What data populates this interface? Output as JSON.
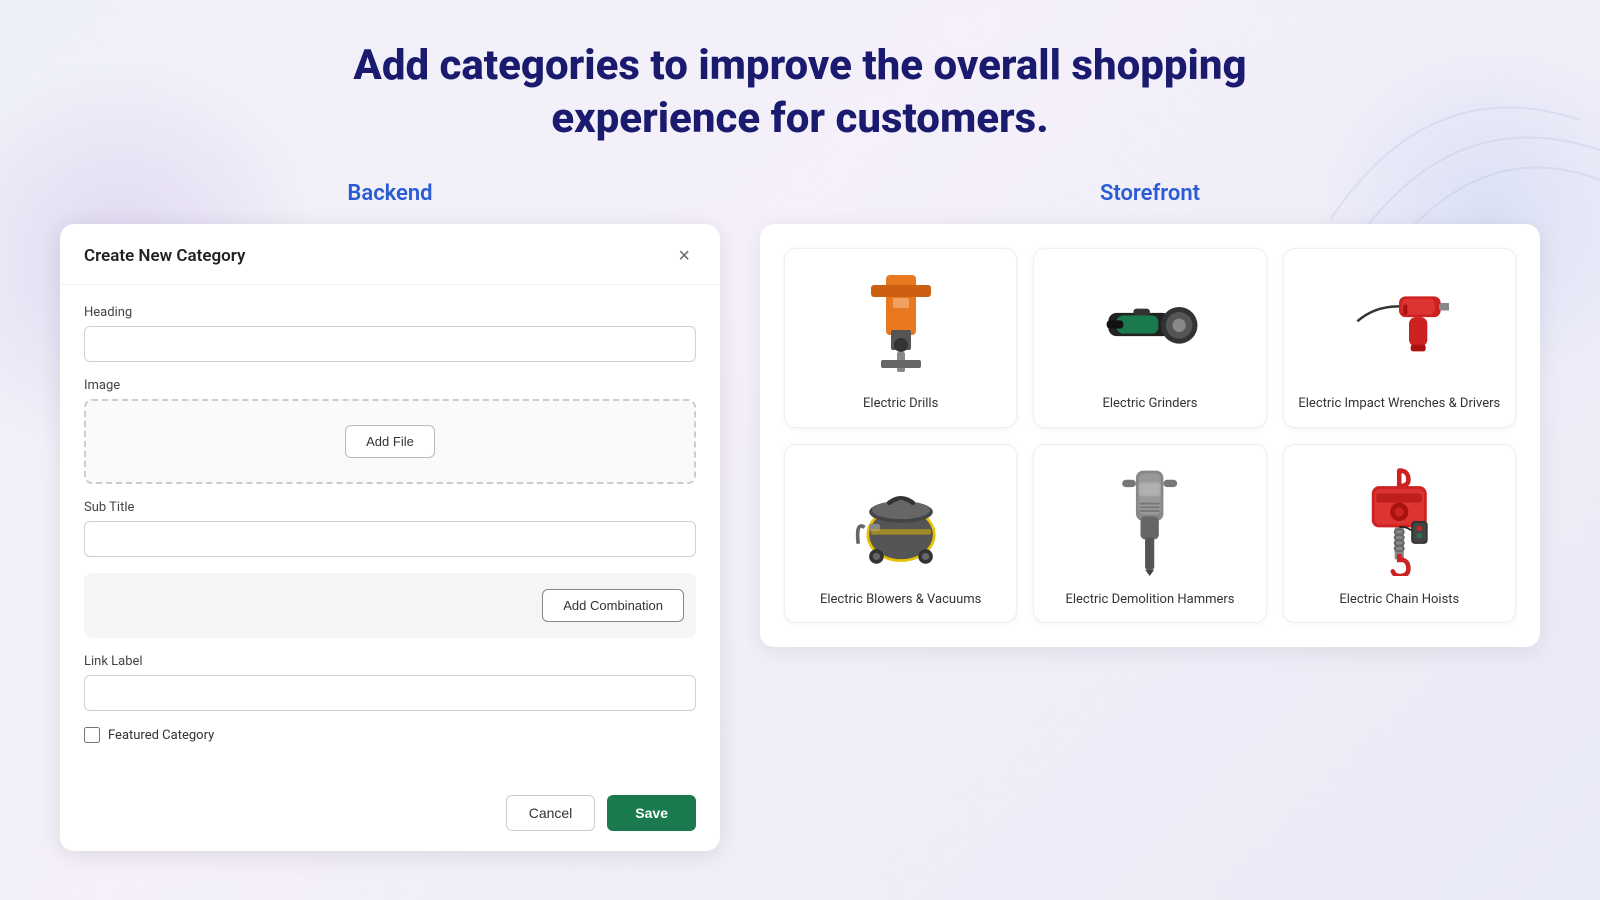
{
  "page": {
    "heading_line1": "Add categories to improve the overall shopping",
    "heading_line2": "experience for customers.",
    "backend_label": "Backend",
    "storefront_label": "Storefront"
  },
  "modal": {
    "title": "Create New Category",
    "close_icon": "×",
    "heading_label": "Heading",
    "heading_placeholder": "",
    "image_label": "Image",
    "add_file_button": "Add File",
    "subtitle_label": "Sub Title",
    "subtitle_placeholder": "",
    "add_combination_button": "Add Combination",
    "link_label_label": "Link Label",
    "link_label_placeholder": "",
    "featured_category_label": "Featured Category",
    "cancel_button": "Cancel",
    "save_button": "Save"
  },
  "products": [
    {
      "id": "electric-drills",
      "name": "Electric Drills",
      "color1": "#e87820",
      "color2": "#555"
    },
    {
      "id": "electric-grinders",
      "name": "Electric Grinders",
      "color1": "#222",
      "color2": "#1a7a4e"
    },
    {
      "id": "electric-impact-wrenches",
      "name": "Electric Impact Wrenches & Drivers",
      "color1": "#cc2222",
      "color2": "#555"
    },
    {
      "id": "electric-blowers-vacuums",
      "name": "Electric Blowers & Vacuums",
      "color1": "#444",
      "color2": "#e8c000"
    },
    {
      "id": "electric-demolition-hammers",
      "name": "Electric Demolition Hammers",
      "color1": "#888",
      "color2": "#333"
    },
    {
      "id": "electric-chain-hoists",
      "name": "Electric Chain Hoists",
      "color1": "#cc2222",
      "color2": "#555"
    }
  ]
}
